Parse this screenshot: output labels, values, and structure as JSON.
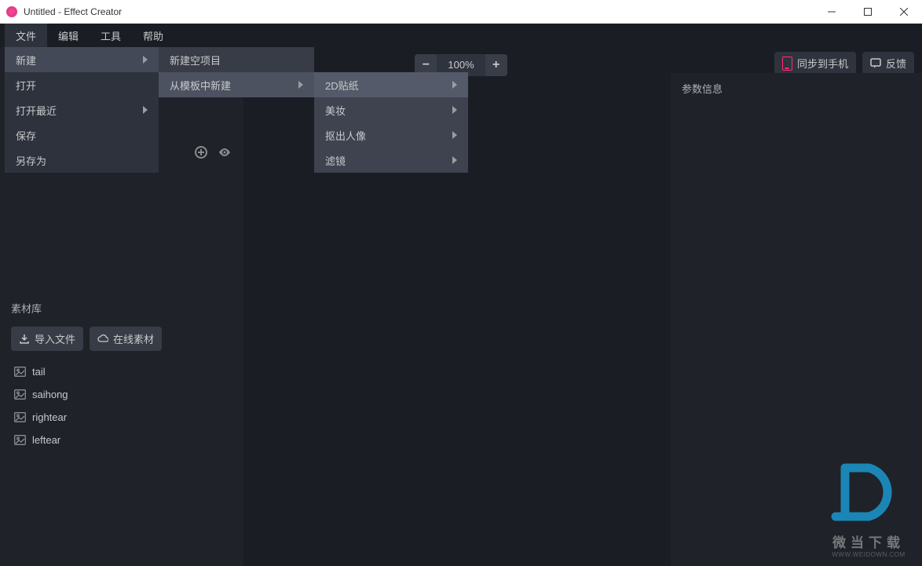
{
  "window": {
    "title": "Untitled - Effect Creator"
  },
  "menubar": {
    "file": "文件",
    "edit": "编辑",
    "tools": "工具",
    "help": "帮助"
  },
  "file_menu": {
    "new": "新建",
    "open": "打开",
    "open_recent": "打开最近",
    "save": "保存",
    "save_as": "另存为"
  },
  "new_submenu": {
    "new_empty": "新建空项目",
    "new_from_template": "从模板中新建"
  },
  "template_submenu": {
    "sticker_2d": "2D贴纸",
    "beauty": "美妆",
    "cutout_portrait": "抠出人像",
    "filter": "滤镜"
  },
  "toolbar": {
    "zoom": "100%",
    "sync_phone": "同步到手机",
    "feedback": "反馈"
  },
  "right_panel": {
    "title": "参数信息"
  },
  "asset_library": {
    "title": "素材库",
    "import_btn": "导入文件",
    "online_btn": "在线素材",
    "items": [
      "tail",
      "saihong",
      "rightear",
      "leftear"
    ]
  },
  "watermark": {
    "name": "微当下载",
    "url": "WWW.WEIDOWN.COM"
  }
}
